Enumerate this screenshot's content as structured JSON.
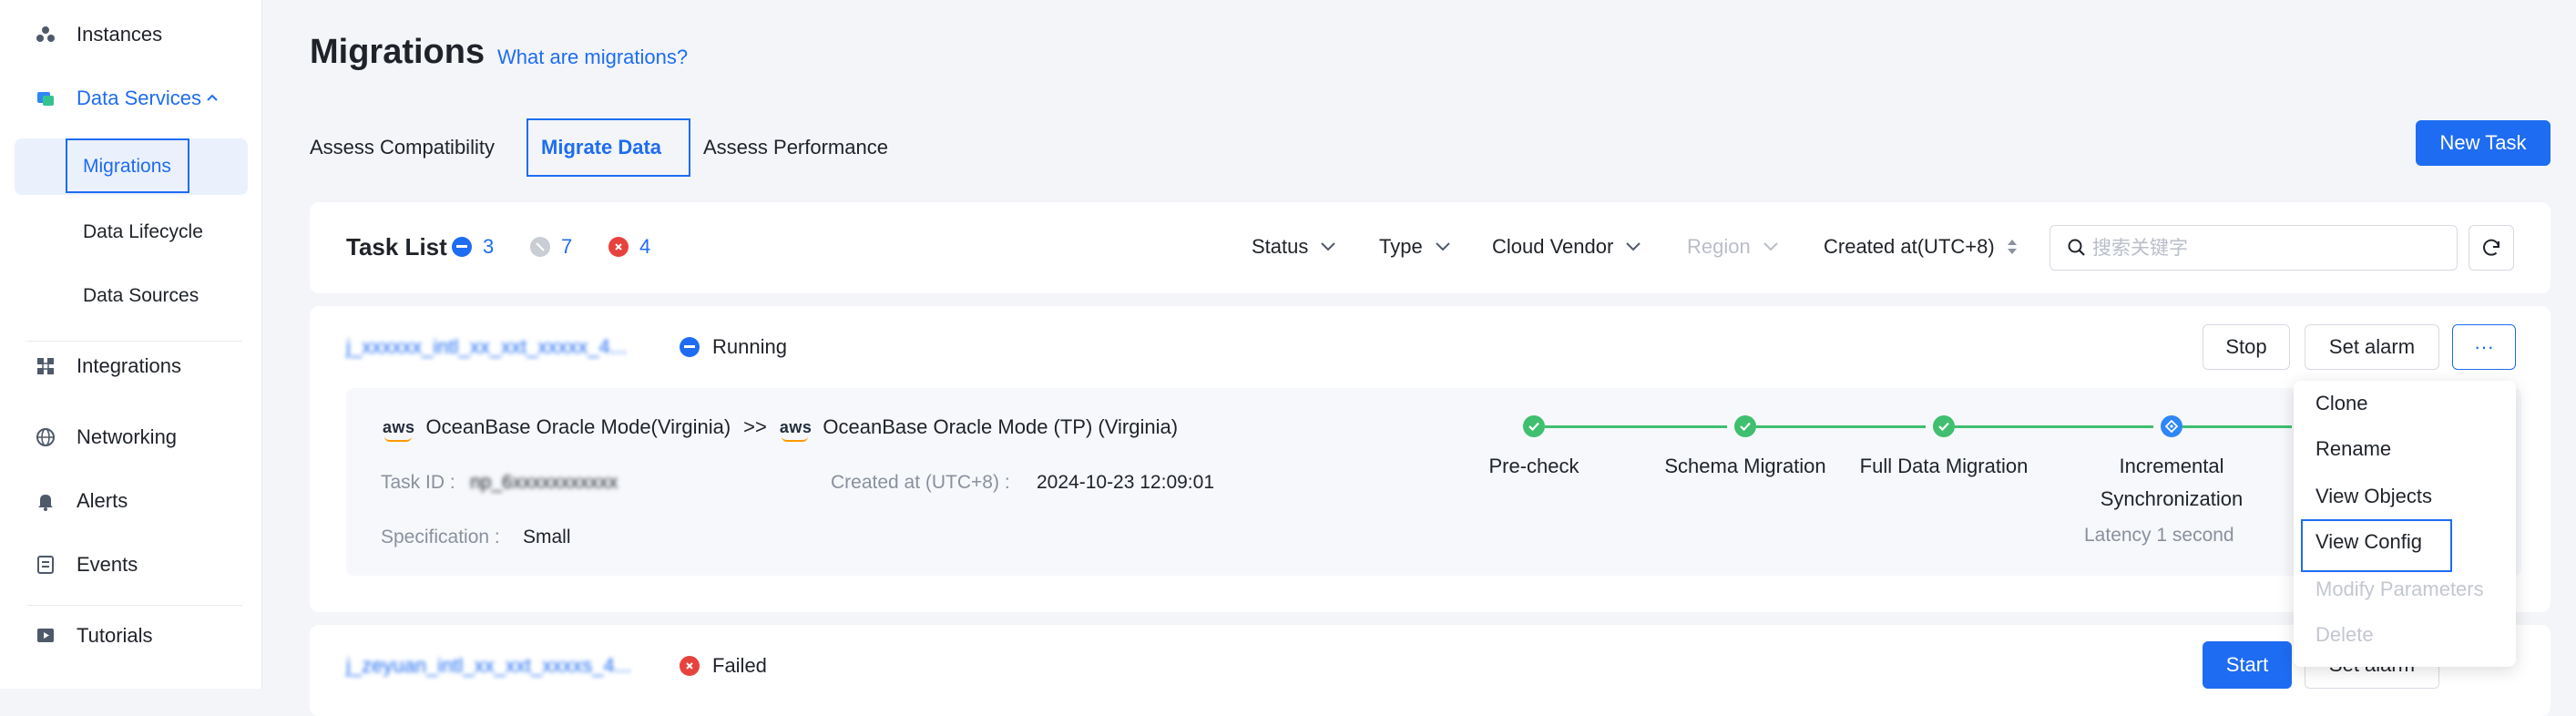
{
  "sidebar": {
    "items": [
      {
        "label": "Instances",
        "icon": "instances-icon"
      },
      {
        "label": "Data Services",
        "icon": "data-services-icon",
        "expanded": true
      },
      {
        "label": "Integrations",
        "icon": "integrations-icon"
      },
      {
        "label": "Networking",
        "icon": "networking-icon"
      },
      {
        "label": "Alerts",
        "icon": "alerts-icon"
      },
      {
        "label": "Events",
        "icon": "events-icon"
      },
      {
        "label": "Tutorials",
        "icon": "tutorials-icon"
      }
    ],
    "sub_items": [
      {
        "label": "Migrations",
        "selected": true
      },
      {
        "label": "Data Lifecycle"
      },
      {
        "label": "Data Sources"
      }
    ]
  },
  "header": {
    "title": "Migrations",
    "help_link": "What are migrations?"
  },
  "tabs": [
    {
      "label": "Assess Compatibility"
    },
    {
      "label": "Migrate Data",
      "active": true
    },
    {
      "label": "Assess Performance"
    }
  ],
  "new_task_label": "New Task",
  "toolbar": {
    "title": "Task List",
    "counts": [
      {
        "value": "3",
        "kind": "running",
        "color": "#1e6cf2"
      },
      {
        "value": "7",
        "kind": "stopped",
        "color": "#c9cdd4"
      },
      {
        "value": "4",
        "kind": "failed",
        "color": "#e8423d"
      }
    ],
    "filters": [
      {
        "label": "Status"
      },
      {
        "label": "Type"
      },
      {
        "label": "Cloud Vendor"
      },
      {
        "label": "Region",
        "disabled": true
      },
      {
        "label": "Created at(UTC+8)"
      }
    ],
    "search_placeholder": "搜索关键字"
  },
  "tasks": [
    {
      "name": "j_xxxxxx_intl_xx_xxt_xxxxx_4...",
      "status": "Running",
      "status_color": "#1e6cf2",
      "source": "OceanBase Oracle Mode(Virginia)",
      "arrow": ">>",
      "target": "OceanBase Oracle Mode (TP) (Virginia)",
      "vendor_logo": "aws",
      "task_id_label": "Task ID :",
      "task_id": "np_6xxxxxxxxxxx",
      "created_label": "Created at (UTC+8) :",
      "created_at": "2024-10-23 12:09:01",
      "spec_label": "Specification :",
      "spec": "Small",
      "steps": [
        "Pre-check",
        "Schema Migration",
        "Full Data Migration",
        "Incremental Synchronization"
      ],
      "latency": "Latency 1 second",
      "actions": {
        "stop": "Stop",
        "alarm": "Set alarm",
        "more": "···"
      }
    },
    {
      "name": "j_zeyuan_intl_xx_xxt_xxxxs_4...",
      "status": "Failed",
      "status_color": "#e8423d",
      "actions": {
        "start": "Start",
        "alarm": "Set alarm"
      }
    }
  ],
  "menu": {
    "items": [
      {
        "label": "Clone"
      },
      {
        "label": "Rename"
      },
      {
        "label": "View Objects"
      },
      {
        "label": "View Config",
        "focused": true
      },
      {
        "label": "Modify Parameters",
        "disabled": true
      },
      {
        "label": "Delete",
        "disabled": true
      }
    ]
  }
}
